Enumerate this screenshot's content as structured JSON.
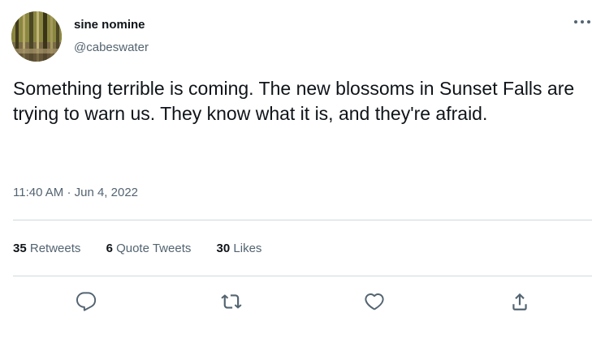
{
  "author": {
    "name": "sine nomine",
    "handle": "@cabeswater"
  },
  "tweet": {
    "text": "Something terrible is coming. The new blossoms in Sunset Falls are trying to warn us. They know what it is, and they're afraid.",
    "time": "11:40 AM",
    "separator": "·",
    "date": "Jun 4, 2022"
  },
  "stats": {
    "retweets_count": "35",
    "retweets_label": "Retweets",
    "quote_count": "6",
    "quote_label": "Quote Tweets",
    "likes_count": "30",
    "likes_label": "Likes"
  },
  "icons": {
    "more": "more-horizontal-icon",
    "reply": "reply-icon",
    "retweet": "retweet-icon",
    "like": "heart-icon",
    "share": "share-icon"
  },
  "colors": {
    "primary_text": "#0f1419",
    "secondary_text": "#536471",
    "divider": "#cfd9de"
  }
}
